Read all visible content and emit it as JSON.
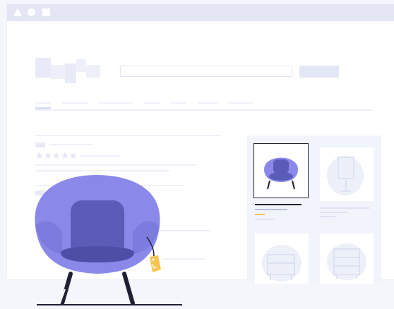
{
  "window": {
    "controls": [
      "triangle-icon",
      "circle-icon",
      "square-icon"
    ]
  },
  "header": {
    "logo": "logo-placeholder-icon",
    "search": {
      "placeholder": "",
      "value": ""
    },
    "search_button": ""
  },
  "product": {
    "rating": {
      "stars": 5
    }
  },
  "thumbnails": [
    "armchair-thumbnail-icon",
    "floor-lamp-thumbnail-icon",
    "nightstand-thumbnail-icon",
    "dresser-thumbnail-icon"
  ],
  "colors": {
    "chair": "#8a89ea",
    "chair_dark": "#5b5bb8",
    "tag": "#f5c451",
    "placeholder": "#e8ebf7",
    "frame": "#e4e6f5"
  }
}
